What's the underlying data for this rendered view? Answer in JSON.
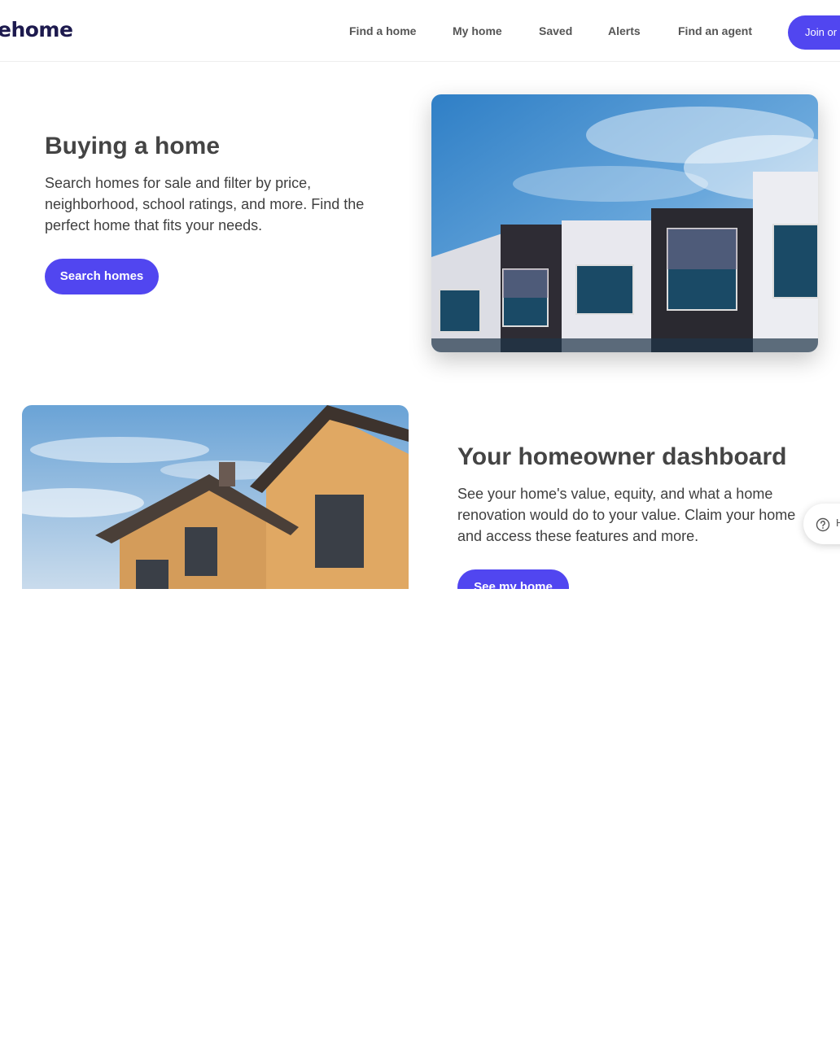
{
  "header": {
    "logo_text": "ehome",
    "nav": [
      {
        "label": "Find a home"
      },
      {
        "label": "My home"
      },
      {
        "label": "Saved"
      },
      {
        "label": "Alerts"
      },
      {
        "label": "Find an agent"
      }
    ],
    "join_label": "Join or"
  },
  "section_buying": {
    "title": "Buying a home",
    "description": "Search homes for sale and filter by price, neighborhood, school ratings, and more. Find the perfect home that fits your needs.",
    "button_label": "Search homes"
  },
  "section_dashboard": {
    "title": "Your homeowner dashboard",
    "description": "See your home's value, equity, and what a home renovation would do to your value. Claim your home and access these features and more.",
    "button_label": "See my home"
  },
  "help": {
    "label": "H",
    "icon": "question-circle-icon"
  },
  "colors": {
    "accent": "#5146f0",
    "logo": "#1d1a4e"
  }
}
